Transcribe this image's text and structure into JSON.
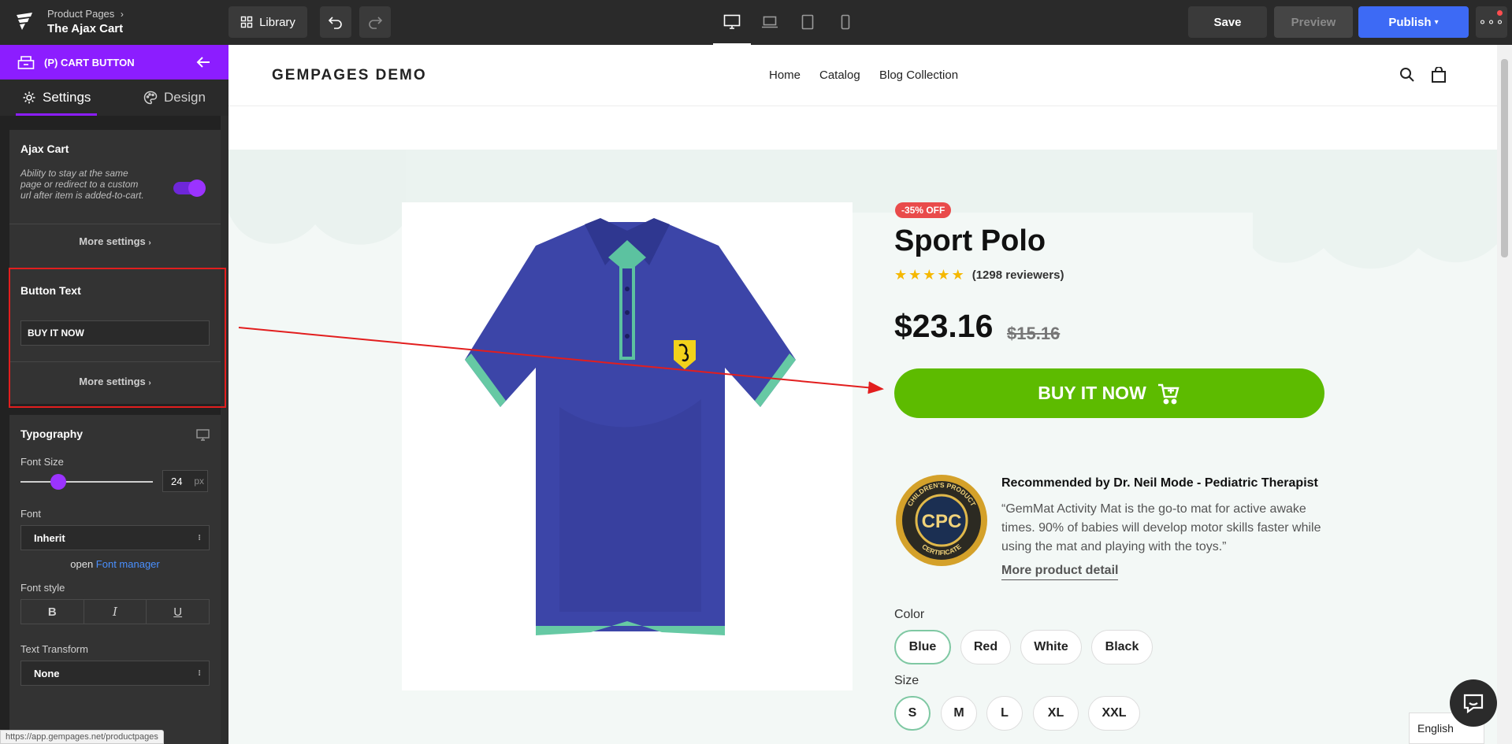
{
  "topbar": {
    "breadcrumb": "Product Pages",
    "page_name": "The Ajax Cart",
    "library_label": "Library",
    "save_label": "Save",
    "preview_label": "Preview",
    "publish_label": "Publish",
    "devices": [
      "desktop",
      "laptop",
      "tablet",
      "mobile"
    ],
    "active_device": "desktop"
  },
  "panel": {
    "element_title": "(P) CART BUTTON",
    "tabs": {
      "settings": "Settings",
      "design": "Design"
    },
    "ajax_cart": {
      "title": "Ajax Cart",
      "hint": "Ability to stay at the same page or redirect to a custom url after item is added-to-cart.",
      "enabled": true,
      "more_settings": "More settings"
    },
    "button_text": {
      "title": "Button Text",
      "value": "BUY IT NOW",
      "more_settings": "More settings"
    },
    "typography": {
      "title": "Typography",
      "font_size_label": "Font Size",
      "font_size_value": "24",
      "font_size_unit": "px",
      "font_label": "Font",
      "font_value": "Inherit",
      "open_text": "open",
      "font_manager": "Font manager",
      "font_style_label": "Font style",
      "style_bold": "B",
      "style_italic": "I",
      "style_underline": "U",
      "transform_label": "Text Transform",
      "transform_value": "None"
    },
    "status_url": "https://app.gempages.net/productpages"
  },
  "site": {
    "brand": "GEMPAGES DEMO",
    "nav": [
      "Home",
      "Catalog",
      "Blog Collection"
    ]
  },
  "product": {
    "badge": "-35% OFF",
    "title": "Sport Polo",
    "rating": 5,
    "reviews": "(1298 reviewers)",
    "price": "$23.16",
    "compare_price": "$15.16",
    "cta": "BUY IT NOW",
    "seal": {
      "top": "CHILDREN'S PRODUCT",
      "center": "CPC",
      "bottom": "CERTIFICATE"
    },
    "recommendation_title": "Recommended by Dr. Neil Mode - Pediatric Therapist",
    "recommendation_quote": "“GemMat Activity Mat is the go-to mat for active awake times. 90% of babies will develop motor skills faster while using the mat and playing with the toys.”",
    "more_detail": "More product detail",
    "color_label": "Color",
    "colors": [
      "Blue",
      "Red",
      "White",
      "Black"
    ],
    "selected_color": "Blue",
    "size_label": "Size",
    "sizes": [
      "S",
      "M",
      "L",
      "XL",
      "XXL"
    ],
    "selected_size": "S"
  },
  "language": "English",
  "colors": {
    "accent_purple": "#8c1dff",
    "publish_blue": "#3d6af5",
    "cta_green": "#5dbb00",
    "highlight_red": "#e21e1e",
    "shirt_blue": "#3c45a8",
    "shirt_trim": "#66c9a4"
  }
}
